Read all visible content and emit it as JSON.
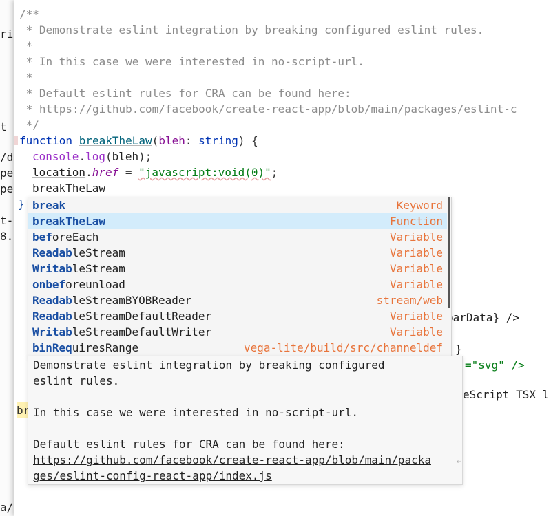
{
  "background_fragments": [
    "ric",
    "t",
    "/d",
    "pe",
    "pe",
    "t-",
    "8.",
    "a/"
  ],
  "background_blue": [
    "fu"
  ],
  "right_fragments": {
    "bar_data": "barData} />",
    "brace": "}",
    "svg": "=\"svg\" />",
    "tsx": "eScript TSX l"
  },
  "code": {
    "doc_open": "/**",
    "c1": " * Demonstrate eslint integration by breaking configured eslint rules.",
    "c2": " *",
    "c3": " * In this case we were interested in no-script-url.",
    "c4": " *",
    "c5": " * Default eslint rules for CRA can be found here:",
    "c6": " * https://github.com/facebook/create-react-app/blob/main/packages/eslint-c",
    "doc_close": " */",
    "fn_kw": "function",
    "fn_name": "breakTheLaw",
    "param": "bleh",
    "param_type": "string",
    "console_obj": "console",
    "console_method": "log",
    "console_arg": "bleh",
    "location_obj": "location",
    "location_prop": "href",
    "js_url": "\"javascript:void(0)\"",
    "typed": "breakTheLaw",
    "closing_brace": "}",
    "lone_b": "br"
  },
  "completion": {
    "items": [
      {
        "match": "break",
        "rest": "",
        "type": "Keyword"
      },
      {
        "match": "breakTheLaw",
        "rest": "",
        "type": "Function",
        "selected": true
      },
      {
        "match": "bef",
        "rest": "oreEach",
        "type": "Variable"
      },
      {
        "match": "Readab",
        "rest": "leStream",
        "type": "Variable"
      },
      {
        "match": "Writab",
        "rest": "leStream",
        "type": "Variable"
      },
      {
        "match": "onbef",
        "rest": "oreunload",
        "type": "Variable"
      },
      {
        "match": "Readab",
        "rest": "leStreamBYOBReader",
        "type": "stream/web"
      },
      {
        "match": "Readab",
        "rest": "leStreamDefaultReader",
        "type": "Variable"
      },
      {
        "match": "Writab",
        "rest": "leStreamDefaultWriter",
        "type": "Variable"
      },
      {
        "match": "binReq",
        "rest": "uiresRange",
        "type": "vega-lite/build/src/channeldef"
      }
    ]
  },
  "doc_popup": {
    "line1": "Demonstrate eslint integration by breaking configured",
    "line2": "eslint rules.",
    "line3": "In this case we were interested in no-script-url.",
    "line4": "Default eslint rules for CRA can be found here:",
    "link1": "https://github.com/facebook/create-react-app/blob/main/packa",
    "link2": "ges/eslint-config-react-app/index.js"
  }
}
